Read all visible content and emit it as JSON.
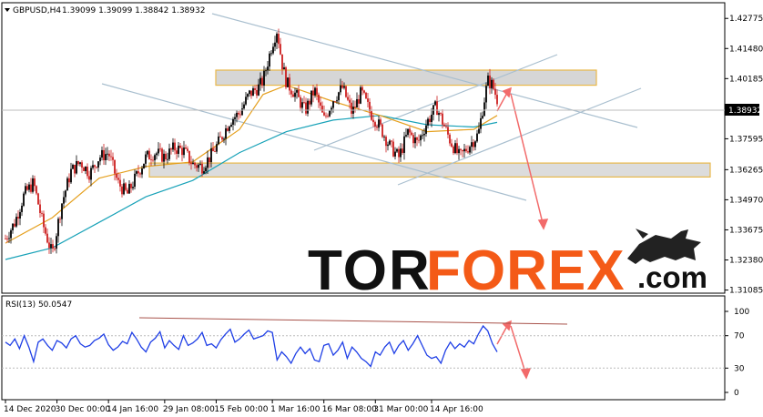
{
  "header": {
    "triangle_icon": "triangle-down-icon",
    "symbol": "GBPUSD,H4",
    "ohlc": "1.39099 1.39099 1.38842 1.38932"
  },
  "rsi_header": "RSI(13) 50.0547",
  "logo": {
    "tor": "TOR",
    "forex": "FOREX",
    "com": ".com",
    "icon": "bull-icon"
  },
  "colors": {
    "bull_candle": "#000000",
    "bear_candle": "#cc1f1f",
    "ma_slow": "#18a2b8",
    "ma_fast": "#e5a01f",
    "ma_mid": "#4caf50",
    "rsi_line": "#1f3fe6",
    "zone_border": "#e8b84a",
    "zone_fill": "#d6d6d6",
    "channel_line": "#a9bfcf",
    "forecast_arrow": "#f26a6a",
    "logo_orange": "#f45a17"
  },
  "chart_data": [
    {
      "type": "candlestick",
      "symbol": "GBPUSD",
      "timeframe": "H4",
      "title": "GBPUSD,H4",
      "last_price": "1.38932",
      "y_ticks": [
        "1.42775",
        "1.41480",
        "1.40185",
        "1.38932",
        "1.37595",
        "1.36265",
        "1.34970",
        "1.33675",
        "1.32380",
        "1.31085"
      ],
      "x_ticks": [
        "14 Dec 2020",
        "30 Dec 00:00",
        "14 Jan 16:00",
        "29 Jan 08:00",
        "15 Feb 00:00",
        "1 Mar 16:00",
        "16 Mar 08:00",
        "31 Mar 00:00",
        "14 Apr 16:00"
      ],
      "ylim": [
        1.3095,
        1.4345
      ],
      "price_path": [
        [
          0,
          1.333
        ],
        [
          2,
          1.34
        ],
        [
          4,
          1.352
        ],
        [
          6,
          1.357
        ],
        [
          8,
          1.339
        ],
        [
          10,
          1.326
        ],
        [
          12,
          1.348
        ],
        [
          14,
          1.362
        ],
        [
          16,
          1.366
        ],
        [
          18,
          1.361
        ],
        [
          20,
          1.368
        ],
        [
          22,
          1.37
        ],
        [
          24,
          1.357
        ],
        [
          26,
          1.352
        ],
        [
          28,
          1.36
        ],
        [
          30,
          1.368
        ],
        [
          32,
          1.37
        ],
        [
          34,
          1.368
        ],
        [
          36,
          1.372
        ],
        [
          38,
          1.371
        ],
        [
          40,
          1.365
        ],
        [
          42,
          1.364
        ],
        [
          44,
          1.369
        ],
        [
          46,
          1.376
        ],
        [
          48,
          1.384
        ],
        [
          50,
          1.387
        ],
        [
          52,
          1.395
        ],
        [
          54,
          1.398
        ],
        [
          55,
          1.401
        ],
        [
          57,
          1.417
        ],
        [
          58,
          1.423
        ],
        [
          59,
          1.409
        ],
        [
          60,
          1.4
        ],
        [
          62,
          1.395
        ],
        [
          64,
          1.388
        ],
        [
          66,
          1.397
        ],
        [
          68,
          1.384
        ],
        [
          70,
          1.393
        ],
        [
          72,
          1.398
        ],
        [
          74,
          1.387
        ],
        [
          76,
          1.396
        ],
        [
          78,
          1.387
        ],
        [
          80,
          1.381
        ],
        [
          82,
          1.373
        ],
        [
          84,
          1.368
        ],
        [
          86,
          1.379
        ],
        [
          88,
          1.374
        ],
        [
          90,
          1.383
        ],
        [
          92,
          1.39
        ],
        [
          93,
          1.385
        ],
        [
          95,
          1.375
        ],
        [
          97,
          1.368
        ],
        [
          99,
          1.373
        ],
        [
          101,
          1.378
        ],
        [
          102,
          1.39
        ],
        [
          103,
          1.401
        ],
        [
          104,
          1.399
        ],
        [
          105,
          1.393
        ]
      ],
      "x_tick_index": [
        0,
        11,
        22,
        34,
        45,
        57,
        68,
        79,
        91
      ],
      "moving_averages": [
        {
          "name": "MA slow",
          "color": "#18a2b8",
          "points": [
            [
              0,
              1.324
            ],
            [
              10,
              1.329
            ],
            [
              20,
              1.34
            ],
            [
              30,
              1.351
            ],
            [
              40,
              1.358
            ],
            [
              50,
              1.37
            ],
            [
              60,
              1.379
            ],
            [
              70,
              1.384
            ],
            [
              80,
              1.386
            ],
            [
              90,
              1.382
            ],
            [
              100,
              1.381
            ],
            [
              105,
              1.383
            ]
          ]
        },
        {
          "name": "MA fast",
          "color": "#e5a01f",
          "points": [
            [
              0,
              1.331
            ],
            [
              10,
              1.342
            ],
            [
              20,
              1.359
            ],
            [
              30,
              1.364
            ],
            [
              40,
              1.366
            ],
            [
              50,
              1.38
            ],
            [
              55,
              1.395
            ],
            [
              60,
              1.399
            ],
            [
              70,
              1.392
            ],
            [
              80,
              1.386
            ],
            [
              90,
              1.379
            ],
            [
              100,
              1.38
            ],
            [
              105,
              1.386
            ]
          ]
        }
      ],
      "zones": [
        {
          "from": 1.4055,
          "to": 1.399
        },
        {
          "from": 1.3655,
          "to": 1.3595
        }
      ],
      "forecast": {
        "up_to": 1.3985,
        "down_to": 1.338
      }
    },
    {
      "type": "line",
      "title": "RSI(13) 50.0547",
      "value": 50.0547,
      "y_ticks": [
        "100",
        "70",
        "30",
        "0"
      ],
      "ylim": [
        0,
        100
      ],
      "levels": [
        70,
        30
      ],
      "values": [
        62,
        58,
        66,
        54,
        70,
        56,
        38,
        62,
        66,
        58,
        52,
        64,
        61,
        55,
        66,
        70,
        60,
        56,
        58,
        64,
        67,
        72,
        59,
        52,
        56,
        63,
        60,
        74,
        66,
        56,
        50,
        62,
        67,
        75,
        55,
        64,
        58,
        53,
        70,
        58,
        61,
        66,
        74,
        58,
        60,
        55,
        65,
        72,
        78,
        62,
        66,
        72,
        77,
        66,
        68,
        70,
        76,
        74,
        40,
        50,
        44,
        36,
        48,
        56,
        48,
        54,
        40,
        38,
        58,
        60,
        46,
        52,
        62,
        42,
        56,
        50,
        42,
        38,
        32,
        50,
        46,
        56,
        62,
        48,
        58,
        64,
        52,
        60,
        70,
        58,
        46,
        42,
        44,
        36,
        52,
        62,
        54,
        60,
        56,
        64,
        60,
        72,
        82,
        76,
        60,
        50
      ]
    }
  ]
}
